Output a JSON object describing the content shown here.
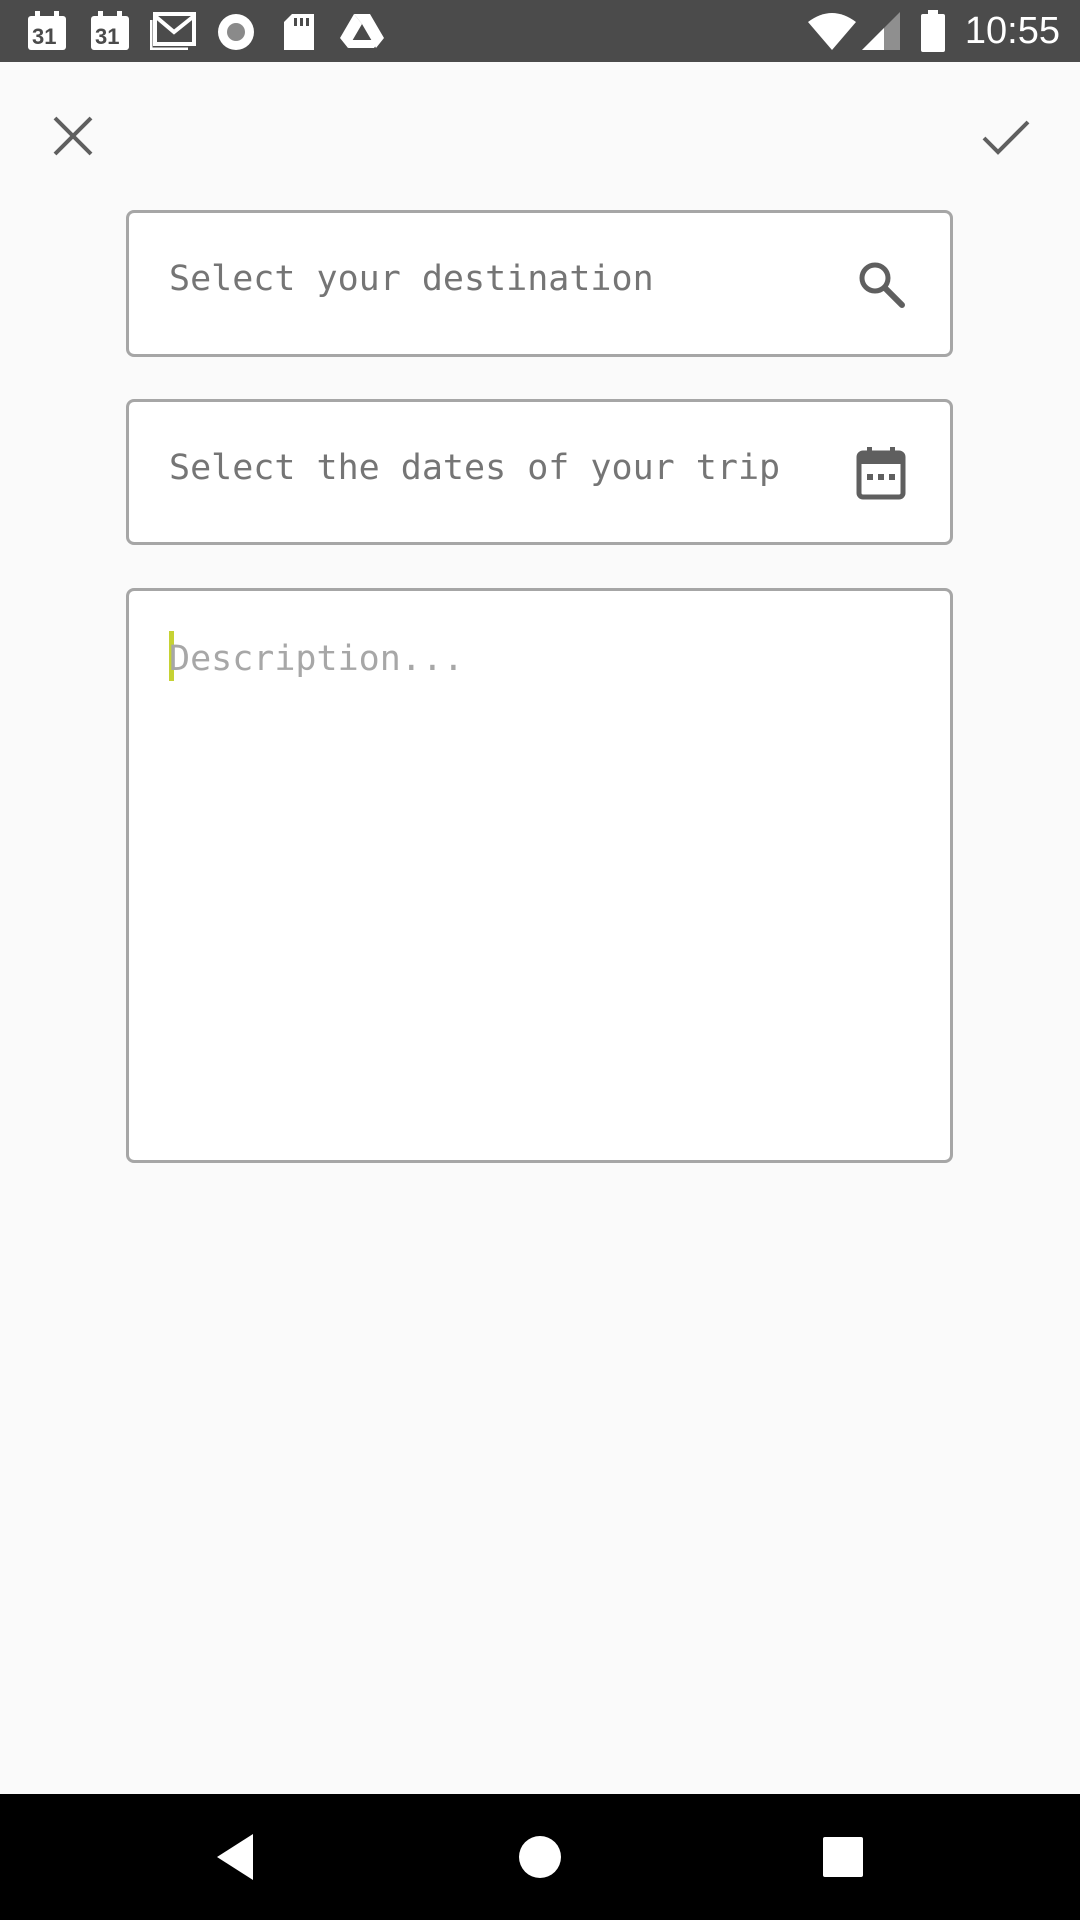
{
  "status_bar": {
    "notification_icons": [
      "calendar-icon",
      "calendar-icon",
      "gmail-icon",
      "record-icon",
      "sd-card-icon",
      "drive-icon"
    ],
    "calendar_day_1": "31",
    "calendar_day_2": "31",
    "time": "10:55"
  },
  "toolbar": {
    "close_icon": "close-icon",
    "confirm_icon": "check-icon"
  },
  "form": {
    "destination_placeholder": "Select your destination",
    "dates_placeholder": "Select the dates of your trip",
    "description_placeholder": "Description..."
  },
  "colors": {
    "status_bar_bg": "#4b4b4b",
    "page_bg": "#fafafa",
    "field_border": "#a6a6a6",
    "caret": "#c6d233",
    "icon_gray": "#5f5f5f"
  },
  "nav_bar": {
    "buttons": [
      "back-icon",
      "home-icon",
      "recents-icon"
    ]
  }
}
